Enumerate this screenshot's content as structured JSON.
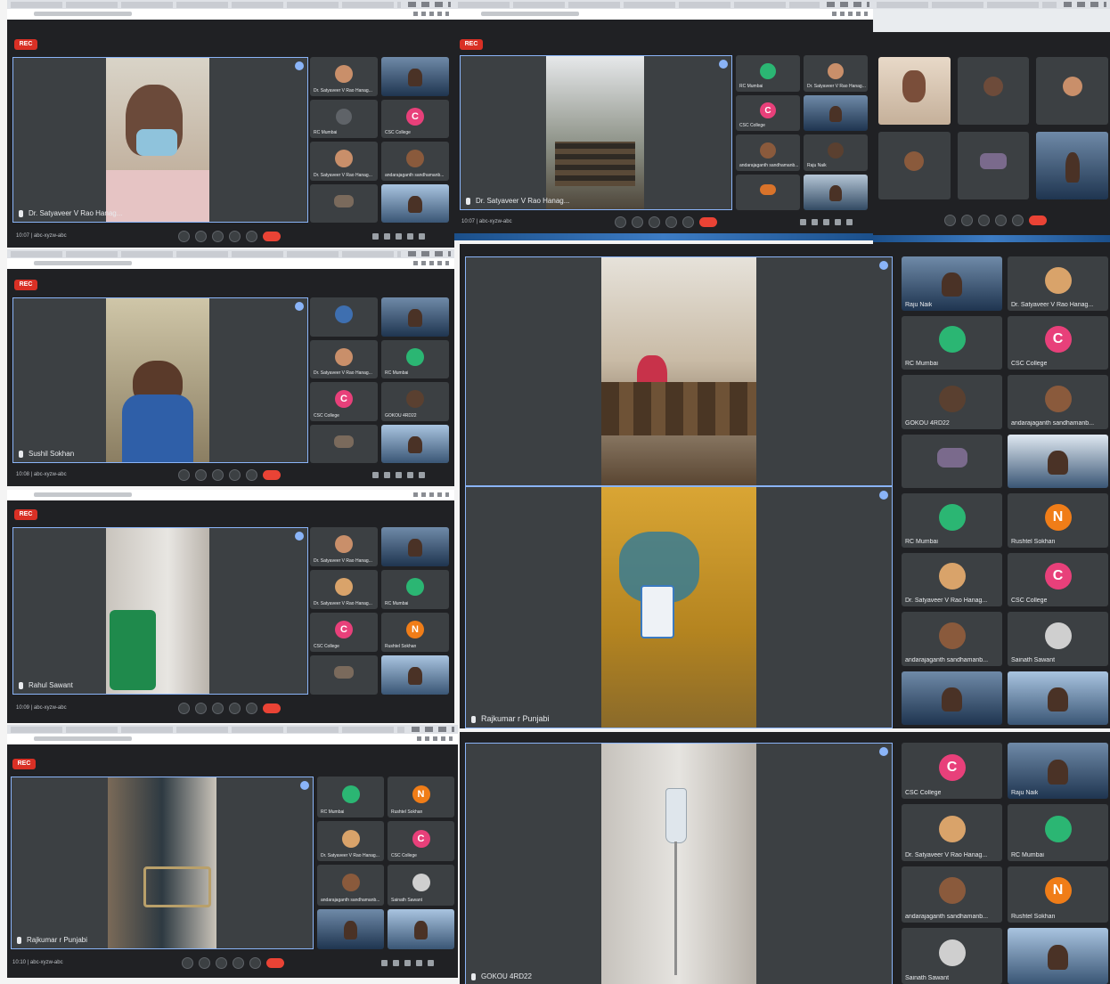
{
  "recording_badge": "REC",
  "colors": {
    "meet_bg": "#202124",
    "tile_bg": "#3c4043",
    "accent": "#8ab4f8",
    "end_call": "#ea4335",
    "avatar_green": "#2bb673",
    "avatar_pink": "#e8407a",
    "avatar_orange": "#f07d18"
  },
  "participants": {
    "rk_mumbai": "RC Mumbai",
    "csc": "CSC College",
    "satyaveer": "Dr. Satyaveer V Rao Hanag...",
    "andhra": "andarajaganth sandhamanb...",
    "rahul": "Rushtel Sokhan",
    "raju": "Raju Naik",
    "samath": "Sainath Sawant",
    "rajkumar": "Rajkumar r Punjabi",
    "gokul": "GOKOU 4RD22",
    "c_letter": "C",
    "n_letter": "N"
  },
  "windows": [
    {
      "id": "w1",
      "presenter": "Dr. Satyaveer V Rao Hanag...",
      "meet": "10:07 | abc-xyzw-abc"
    },
    {
      "id": "w2",
      "presenter": "Dr. Satyaveer V Rao Hanag...",
      "meet": "10:07 | abc-xyzw-abc"
    },
    {
      "id": "w3",
      "presenter": "",
      "meet": ""
    },
    {
      "id": "w4",
      "presenter": "Sushil Sokhan",
      "meet": "10:08 | abc-xyzw-abc"
    },
    {
      "id": "w5",
      "presenter": "Rahul Sawant",
      "meet": "10:09 | abc-xyzw-abc"
    },
    {
      "id": "w6",
      "presenter": "Rajkumar r Punjabi",
      "meet": ""
    },
    {
      "id": "w7",
      "presenter": "Rajkumar r Punjabi",
      "meet": "10:10 | abc-xyzw-abc"
    },
    {
      "id": "w8",
      "presenter": "GOKOU 4RD22",
      "meet": ""
    }
  ]
}
